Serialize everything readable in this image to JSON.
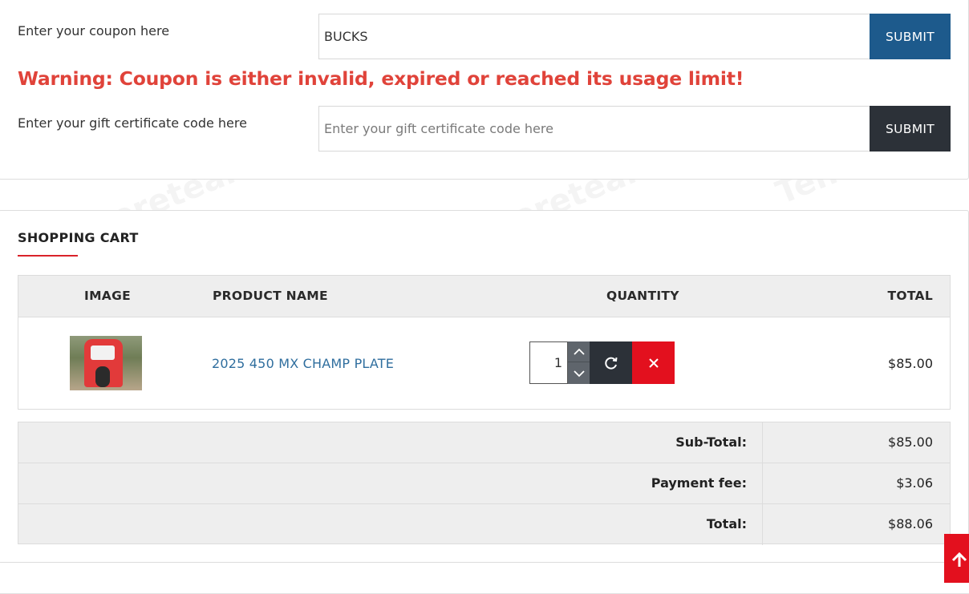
{
  "coupon": {
    "label": "Enter your coupon here",
    "value": "BUCKS",
    "submit_label": "SUBMIT",
    "warning": "Warning: Coupon is either invalid, expired or reached its usage limit!"
  },
  "gift": {
    "label": "Enter your gift certificate code here",
    "placeholder": "Enter your gift certificate code here",
    "submit_label": "SUBMIT"
  },
  "cart": {
    "heading": "SHOPPING CART",
    "columns": {
      "image": "IMAGE",
      "name": "PRODUCT NAME",
      "quantity": "QUANTITY",
      "total": "TOTAL"
    },
    "items": [
      {
        "name": "2025 450 MX CHAMP PLATE",
        "quantity": "1",
        "total": "$85.00"
      }
    ],
    "totals": [
      {
        "label": "Sub-Total:",
        "value": "$85.00"
      },
      {
        "label": "Payment fee:",
        "value": "$3.06"
      },
      {
        "label": "Total:",
        "value": "$88.06"
      }
    ]
  },
  "watermark": "Tenereteam",
  "icons": {
    "quantity_increase": "chevron-up-icon",
    "quantity_decrease": "chevron-down-icon",
    "update": "refresh-icon",
    "remove": "close-icon",
    "scroll_top": "arrow-up-icon"
  },
  "colors": {
    "coupon_submit": "#1d5a8c",
    "gift_submit": "#2c3138",
    "warning": "#e0433a",
    "remove_button": "#e3101e",
    "product_link": "#2f6e9e",
    "heading_accent": "#d9222a"
  }
}
